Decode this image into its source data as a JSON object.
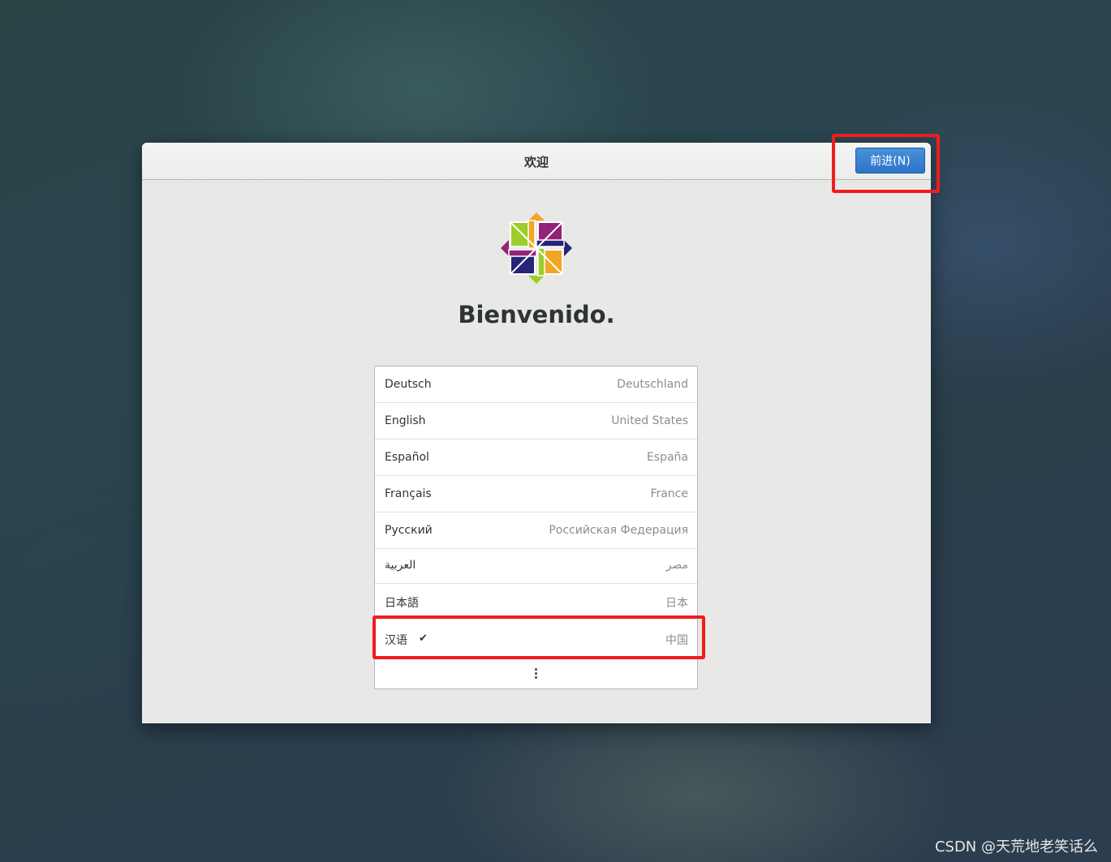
{
  "dialog": {
    "title": "欢迎",
    "next_button_label": "前进(N)",
    "welcome_text": "Bienvenido."
  },
  "languages": [
    {
      "name": "Deutsch",
      "region": "Deutschland",
      "selected": false
    },
    {
      "name": "English",
      "region": "United States",
      "selected": false
    },
    {
      "name": "Español",
      "region": "España",
      "selected": false
    },
    {
      "name": "Français",
      "region": "France",
      "selected": false
    },
    {
      "name": "Русский",
      "region": "Российская Федерация",
      "selected": false
    },
    {
      "name": "العربية",
      "region": "مصر",
      "selected": false
    },
    {
      "name": "日本語",
      "region": "日本",
      "selected": false
    },
    {
      "name": "汉语",
      "region": "中国",
      "selected": true
    }
  ],
  "selected_check": "✔",
  "more_icon": "more-vertical-icon",
  "logo_icon": "centos-logo-icon",
  "watermark": "CSDN @天荒地老笑话么",
  "colors": {
    "accent": "#2b74c7",
    "highlight": "#f01d1d",
    "logo_green": "#9ccd2a",
    "logo_purple": "#932279",
    "logo_orange": "#efa724",
    "logo_navy": "#262577"
  }
}
